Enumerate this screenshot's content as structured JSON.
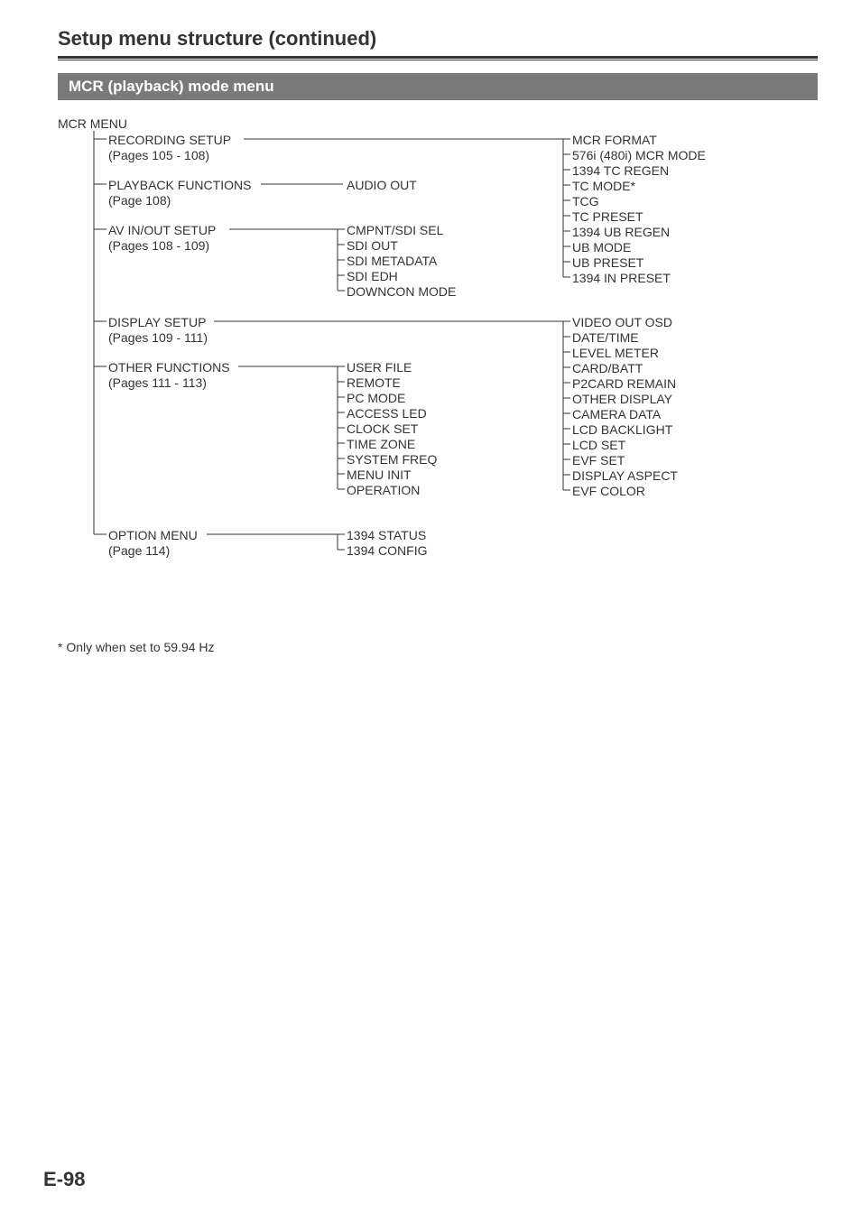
{
  "header": {
    "section_title": "Setup menu structure (continued)",
    "band_title": "MCR (playback) mode menu"
  },
  "tree": {
    "root": "MCR MENU",
    "groups": {
      "recording_setup": {
        "label": "RECORDING SETUP",
        "pages": "(Pages 105 - 108)"
      },
      "playback_functions": {
        "label": "PLAYBACK FUNCTIONS",
        "pages": "(Page 108)",
        "children": [
          "AUDIO OUT"
        ]
      },
      "av_in_out_setup": {
        "label": "AV IN/OUT SETUP",
        "pages": "(Pages 108 - 109)",
        "children": [
          "CMPNT/SDI SEL",
          "SDI OUT",
          "SDI METADATA",
          "SDI EDH",
          "DOWNCON MODE"
        ]
      },
      "display_setup": {
        "label": "DISPLAY SETUP",
        "pages": "(Pages 109 - 111)"
      },
      "other_functions": {
        "label": "OTHER FUNCTIONS",
        "pages": "(Pages 111 - 113)",
        "children": [
          "USER FILE",
          "REMOTE",
          "PC MODE",
          "ACCESS LED",
          "CLOCK SET",
          "TIME ZONE",
          "SYSTEM FREQ",
          "MENU INIT",
          "OPERATION"
        ]
      },
      "option_menu": {
        "label": "OPTION MENU",
        "pages": "(Page 114)",
        "children": [
          "1394 STATUS",
          "1394 CONFIG"
        ]
      }
    },
    "right_column_a": [
      "MCR FORMAT",
      "576i (480i) MCR MODE",
      "1394 TC REGEN",
      "TC MODE*",
      "TCG",
      "TC PRESET",
      "1394 UB REGEN",
      "UB MODE",
      "UB PRESET",
      "1394 IN PRESET"
    ],
    "right_column_b": [
      "VIDEO OUT OSD",
      "DATE/TIME",
      "LEVEL METER",
      "CARD/BATT",
      "P2CARD REMAIN",
      "OTHER DISPLAY",
      "CAMERA DATA",
      "LCD BACKLIGHT",
      "LCD SET",
      "EVF SET",
      "DISPLAY ASPECT",
      "EVF COLOR"
    ]
  },
  "footnote": "* Only when set to 59.94 Hz",
  "page_number": "E-98"
}
